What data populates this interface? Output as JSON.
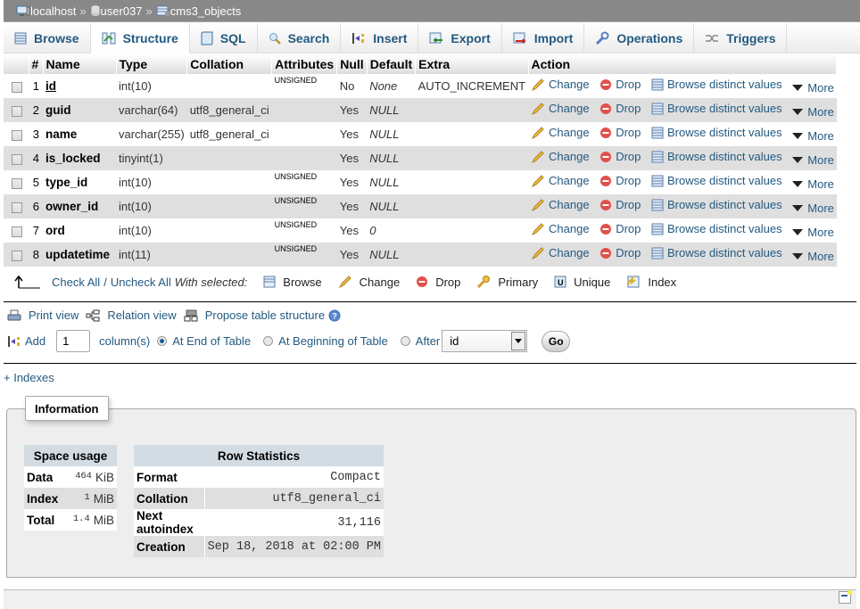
{
  "breadcrumb": {
    "server": "localhost",
    "database": "user037",
    "table": "cms3_objects",
    "separator": "»"
  },
  "tabs": [
    {
      "label": "Browse",
      "icon": "browse-icon"
    },
    {
      "label": "Structure",
      "icon": "structure-icon",
      "active": true
    },
    {
      "label": "SQL",
      "icon": "sql-icon"
    },
    {
      "label": "Search",
      "icon": "search-icon"
    },
    {
      "label": "Insert",
      "icon": "insert-icon"
    },
    {
      "label": "Export",
      "icon": "export-icon"
    },
    {
      "label": "Import",
      "icon": "import-icon"
    },
    {
      "label": "Operations",
      "icon": "wrench-icon"
    },
    {
      "label": "Triggers",
      "icon": "triggers-icon"
    }
  ],
  "columns": {
    "num": "#",
    "name": "Name",
    "type": "Type",
    "collation": "Collation",
    "attributes": "Attributes",
    "null": "Null",
    "default": "Default",
    "extra": "Extra",
    "action": "Action"
  },
  "rows": [
    {
      "num": "1",
      "name": "id",
      "type": "int(10)",
      "collation": "",
      "attributes": "UNSIGNED",
      "null": "No",
      "default": "None",
      "extra": "AUTO_INCREMENT",
      "primary": true
    },
    {
      "num": "2",
      "name": "guid",
      "type": "varchar(64)",
      "collation": "utf8_general_ci",
      "attributes": "",
      "null": "Yes",
      "default": "NULL",
      "extra": ""
    },
    {
      "num": "3",
      "name": "name",
      "type": "varchar(255)",
      "collation": "utf8_general_ci",
      "attributes": "",
      "null": "Yes",
      "default": "NULL",
      "extra": ""
    },
    {
      "num": "4",
      "name": "is_locked",
      "type": "tinyint(1)",
      "collation": "",
      "attributes": "",
      "null": "Yes",
      "default": "NULL",
      "extra": ""
    },
    {
      "num": "5",
      "name": "type_id",
      "type": "int(10)",
      "collation": "",
      "attributes": "UNSIGNED",
      "null": "Yes",
      "default": "NULL",
      "extra": ""
    },
    {
      "num": "6",
      "name": "owner_id",
      "type": "int(10)",
      "collation": "",
      "attributes": "UNSIGNED",
      "null": "Yes",
      "default": "NULL",
      "extra": ""
    },
    {
      "num": "7",
      "name": "ord",
      "type": "int(10)",
      "collation": "",
      "attributes": "UNSIGNED",
      "null": "Yes",
      "default": "0",
      "extra": ""
    },
    {
      "num": "8",
      "name": "updatetime",
      "type": "int(11)",
      "collation": "",
      "attributes": "UNSIGNED",
      "null": "Yes",
      "default": "NULL",
      "extra": ""
    }
  ],
  "row_actions": {
    "change": "Change",
    "drop": "Drop",
    "browse_distinct": "Browse distinct values",
    "more": "More"
  },
  "with_selected": {
    "check_all": "Check All",
    "slash": "/",
    "uncheck_all": "Uncheck All",
    "label": "With selected:",
    "browse": "Browse",
    "change": "Change",
    "drop": "Drop",
    "primary": "Primary",
    "unique": "Unique",
    "index": "Index"
  },
  "links": {
    "print_view": "Print view",
    "relation_view": "Relation view",
    "propose": "Propose table structure"
  },
  "add_column": {
    "label": "Add",
    "count": "1",
    "columns_label": "column(s)",
    "at_end": "At End of Table",
    "at_beginning": "At Beginning of Table",
    "after": "After",
    "after_field": "id",
    "go": "Go",
    "selected": "at_end"
  },
  "indexes_link": "+ Indexes",
  "information": {
    "legend": "Information",
    "space_usage": {
      "title": "Space usage",
      "rows": [
        {
          "label": "Data",
          "value": "464",
          "unit": "KiB"
        },
        {
          "label": "Index",
          "value": "1",
          "unit": "MiB"
        },
        {
          "label": "Total",
          "value": "1.4",
          "unit": "MiB"
        }
      ]
    },
    "row_statistics": {
      "title": "Row Statistics",
      "rows": [
        {
          "label": "Format",
          "value": "Compact"
        },
        {
          "label": "Collation",
          "value": "utf8_general_ci"
        },
        {
          "label": "Next autoindex",
          "value": "31,116"
        },
        {
          "label": "Creation",
          "value": "Sep 18, 2018 at 02:00 PM"
        }
      ]
    }
  }
}
